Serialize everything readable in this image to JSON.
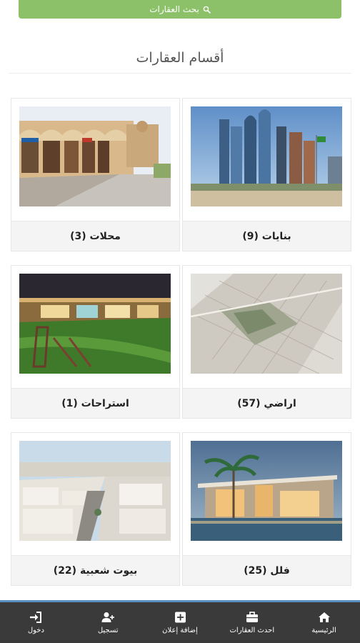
{
  "search": {
    "label": "بحث العقارات",
    "icon": "search-icon"
  },
  "section": {
    "title": "أقسام العقارات"
  },
  "categories": [
    {
      "label": "بنايات (9)",
      "image": "towers-photo"
    },
    {
      "label": "محلات (3)",
      "image": "shops-photo"
    },
    {
      "label": "اراضي (57)",
      "image": "land-aerial-photo"
    },
    {
      "label": "استراحات (1)",
      "image": "resthouse-photo"
    },
    {
      "label": "فلل (25)",
      "image": "villa-photo"
    },
    {
      "label": "بيوت شعبية (22)",
      "image": "folk-houses-photo"
    }
  ],
  "nav": [
    {
      "label": "الرئيسية",
      "icon": "home-icon"
    },
    {
      "label": "احدث العقارات",
      "icon": "briefcase-icon"
    },
    {
      "label": "إضافة إعلان",
      "icon": "plus-square-icon"
    },
    {
      "label": "تسجيل",
      "icon": "user-plus-icon"
    },
    {
      "label": "دخول",
      "icon": "sign-in-icon"
    }
  ],
  "colors": {
    "search_bar": "#8cc16a",
    "nav_bg": "#3a3a3a",
    "nav_accent": "#5a8fc0"
  }
}
